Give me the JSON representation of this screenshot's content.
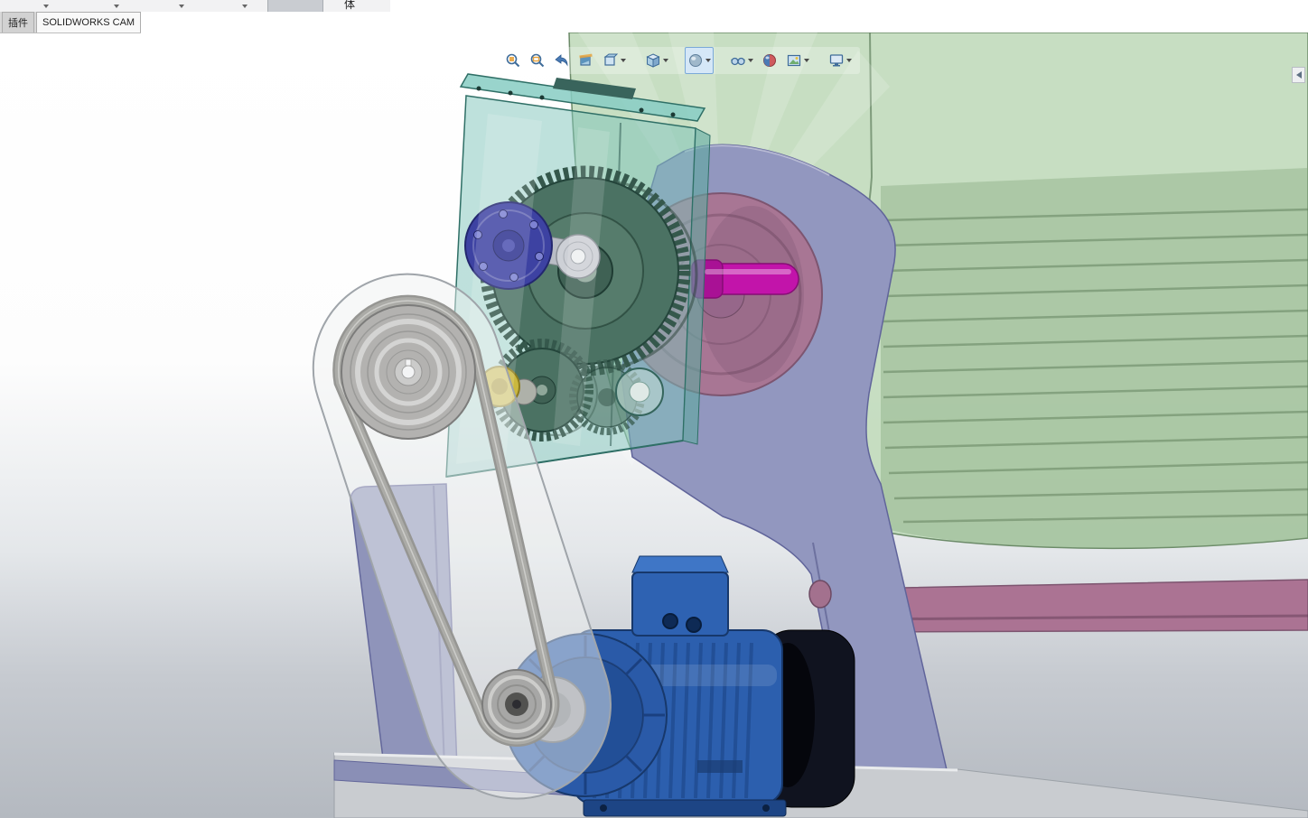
{
  "app": {
    "name": "SOLIDWORKS"
  },
  "ribbon_top": {
    "group_label_partial": "体",
    "dropdowns": [
      "dropdown-1",
      "dropdown-2",
      "dropdown-3",
      "dropdown-4"
    ],
    "pressed_button": "toolbar-pressed-button"
  },
  "tabs": {
    "items": [
      {
        "label": "插件",
        "active": false
      },
      {
        "label": "SOLIDWORKS CAM",
        "active": true
      }
    ]
  },
  "heads_up_toolbar": {
    "buttons": [
      {
        "name": "zoom-to-fit",
        "dropdown": false,
        "selected": false
      },
      {
        "name": "zoom-to-area",
        "dropdown": false,
        "selected": false
      },
      {
        "name": "previous-view",
        "dropdown": false,
        "selected": false
      },
      {
        "name": "section-view",
        "dropdown": false,
        "selected": false
      },
      {
        "name": "3d-drawing-view",
        "dropdown": true,
        "selected": false
      },
      {
        "name": "view-orientation",
        "dropdown": true,
        "selected": false
      },
      {
        "name": "display-style",
        "dropdown": true,
        "selected": true
      },
      {
        "name": "hide-show-items",
        "dropdown": true,
        "selected": false
      },
      {
        "name": "edit-appearance",
        "dropdown": false,
        "selected": false
      },
      {
        "name": "apply-scene",
        "dropdown": true,
        "selected": false
      },
      {
        "name": "view-settings",
        "dropdown": true,
        "selected": false
      }
    ]
  },
  "viewport": {
    "collapse_arrow": "featuremanager-pane-toggle",
    "scene": {
      "type": "3d-assembly",
      "parts": [
        {
          "name": "mill-drum",
          "color": "#bfd9ba"
        },
        {
          "name": "drum-end-flange",
          "color": "#a87694"
        },
        {
          "name": "support-frame",
          "color": "#9297bf"
        },
        {
          "name": "support-beam",
          "color": "#ab7393"
        },
        {
          "name": "support-leg",
          "color": "#8f94ba"
        },
        {
          "name": "base-plate",
          "color": "#c9ccd0"
        },
        {
          "name": "gearbox-housing",
          "color": "#7fc3b9"
        },
        {
          "name": "large-gear",
          "color": "#4b7263"
        },
        {
          "name": "intermediate-gear",
          "color": "#4b7263"
        },
        {
          "name": "pinion-gear",
          "color": "#4b7263"
        },
        {
          "name": "bearing-cover-flange",
          "color": "#3d42a2"
        },
        {
          "name": "output-shaft",
          "color": "#c214aa"
        },
        {
          "name": "yellow-hub",
          "color": "#cbb83f"
        },
        {
          "name": "belt-guard",
          "color": "#eeeff1"
        },
        {
          "name": "v-belt",
          "color": "#8b8b87"
        },
        {
          "name": "large-pulley",
          "color": "#abaaa8"
        },
        {
          "name": "small-pulley",
          "color": "#9e9e9c"
        },
        {
          "name": "electric-motor",
          "color": "#2c5fae"
        },
        {
          "name": "motor-fan-cover",
          "color": "#10131f"
        },
        {
          "name": "motor-terminal-box",
          "color": "#2e62b2"
        }
      ]
    }
  }
}
